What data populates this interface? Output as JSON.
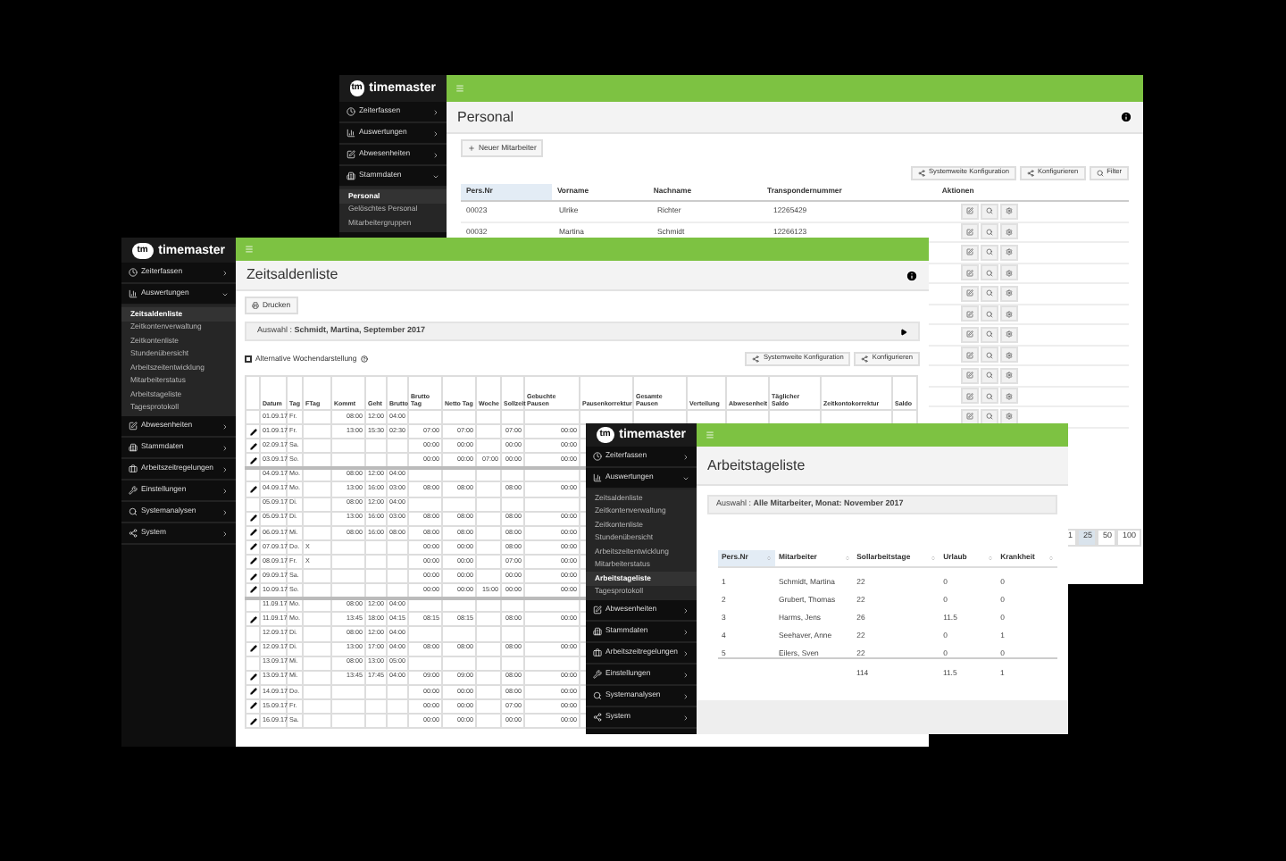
{
  "personal_window": {
    "brand": "timemaster",
    "logo_mark": "tm",
    "sidebar": [
      {
        "label": "Zeiterfassen",
        "expanded": false
      },
      {
        "label": "Auswertungen",
        "expanded": false
      },
      {
        "label": "Abwesenheiten",
        "expanded": false
      },
      {
        "label": "Stammdaten",
        "expanded": true,
        "children": [
          {
            "label": "Personal",
            "selected": true
          },
          {
            "label": "Gelöschtes Personal",
            "selected": false
          },
          {
            "label": "Mitarbeitergruppen",
            "selected": false
          }
        ]
      }
    ],
    "title": "Personal",
    "new_button": "Neuer Mitarbeiter",
    "toolbar": [
      "Systemweite Konfiguration",
      "Konfigurieren",
      "Filter"
    ],
    "columns": [
      {
        "label": "Pers.Nr",
        "sorted": true
      },
      {
        "label": "Vorname",
        "sorted": false
      },
      {
        "label": "Nachname",
        "sorted": false
      },
      {
        "label": "Transpondernummer",
        "sorted": false
      },
      {
        "label": "Aktionen",
        "sorted": false
      }
    ],
    "rows": [
      [
        "00023",
        "Ulrike",
        "Richter",
        "12265429"
      ],
      [
        "00032",
        "Martina",
        "Schmidt",
        "12266123"
      ]
    ],
    "pagination": [
      {
        "label": "1",
        "selected": false
      },
      {
        "label": "25",
        "selected": true
      },
      {
        "label": "50",
        "selected": false
      },
      {
        "label": "100",
        "selected": false
      }
    ]
  },
  "zeitsalden_window": {
    "brand": "timemaster",
    "logo_mark": "tm",
    "sidebar": [
      {
        "label": "Zeiterfassen",
        "expanded": false
      },
      {
        "label": "Auswertungen",
        "expanded": true,
        "children": [
          {
            "label": "Zeitsaldenliste",
            "selected": true
          },
          {
            "label": "Zeitkontenverwaltung",
            "selected": false
          },
          {
            "label": "Zeitkontenliste",
            "selected": false
          },
          {
            "label": "Stundenübersicht",
            "selected": false
          },
          {
            "label": "Arbeitszeitentwicklung",
            "selected": false
          },
          {
            "label": "Mitarbeiterstatus",
            "selected": false
          },
          {
            "label": "Arbeitstageliste",
            "selected": false
          },
          {
            "label": "Tagesprotokoll",
            "selected": false
          }
        ]
      },
      {
        "label": "Abwesenheiten",
        "expanded": false
      },
      {
        "label": "Stammdaten",
        "expanded": false
      },
      {
        "label": "Arbeitszeitregelungen",
        "expanded": false
      },
      {
        "label": "Einstellungen",
        "expanded": false
      },
      {
        "label": "Systemanalysen",
        "expanded": false
      },
      {
        "label": "System",
        "expanded": false
      }
    ],
    "title": "Zeitsaldenliste",
    "print_button": "Drucken",
    "selection": "Auswahl : **Schmidt, Martina, September 2017**",
    "alt_week_view": {
      "label": "Alternative Wochendarstellung",
      "checked": false
    },
    "toolbar": [
      "Systemweite Konfiguration",
      "Konfigurieren"
    ],
    "columns": [
      "Datum",
      "Tag",
      "FTag",
      "Kommt",
      "Geht",
      "Brutto",
      "Brutto Tag",
      "Netto Tag",
      "Woche",
      "Sollzeit",
      "Gebuchte Pausen",
      "Pausenkorrektur",
      "Gesamte Pausen",
      "Verteilung",
      "Abwesenheit",
      "Täglicher Saldo",
      "Zeitkontokorrektur",
      "Saldo"
    ],
    "rows": [
      {
        "edit": false,
        "week_start": false,
        "datum": "01.09.17",
        "tag": "Fr.",
        "kommt": "08:00",
        "geht": "12:00",
        "brutto": "04:00"
      },
      {
        "edit": true,
        "week_start": false,
        "datum": "01.09.17",
        "tag": "Fr.",
        "kommt": "13:00",
        "geht": "15:30",
        "brutto": "02:30",
        "brutto_tag": "07:00",
        "netto_tag": "07:00",
        "sollzeit": "07:00",
        "gebuchte_pausen": "00:00"
      },
      {
        "edit": true,
        "week_start": false,
        "datum": "02.09.17",
        "tag": "Sa.",
        "brutto_tag": "00:00",
        "netto_tag": "00:00",
        "sollzeit": "00:00",
        "gebuchte_pausen": "00:00"
      },
      {
        "edit": true,
        "week_start": false,
        "datum": "03.09.17",
        "tag": "So.",
        "brutto_tag": "00:00",
        "netto_tag": "00:00",
        "woche": "07:00",
        "sollzeit": "00:00",
        "gebuchte_pausen": "00:00"
      },
      {
        "edit": false,
        "week_start": true,
        "datum": "04.09.17",
        "tag": "Mo.",
        "kommt": "08:00",
        "geht": "12:00",
        "brutto": "04:00"
      },
      {
        "edit": true,
        "week_start": false,
        "datum": "04.09.17",
        "tag": "Mo.",
        "kommt": "13:00",
        "geht": "16:00",
        "brutto": "03:00",
        "brutto_tag": "08:00",
        "netto_tag": "08:00",
        "sollzeit": "08:00",
        "gebuchte_pausen": "00:00"
      },
      {
        "edit": false,
        "week_start": false,
        "datum": "05.09.17",
        "tag": "Di.",
        "kommt": "08:00",
        "geht": "12:00",
        "brutto": "04:00"
      },
      {
        "edit": true,
        "week_start": false,
        "datum": "05.09.17",
        "tag": "Di.",
        "kommt": "13:00",
        "geht": "16:00",
        "brutto": "03:00",
        "brutto_tag": "08:00",
        "netto_tag": "08:00",
        "sollzeit": "08:00",
        "gebuchte_pausen": "00:00"
      },
      {
        "edit": true,
        "week_start": false,
        "datum": "06.09.17",
        "tag": "Mi.",
        "kommt": "08:00",
        "geht": "16:00",
        "brutto": "08:00",
        "brutto_tag": "08:00",
        "netto_tag": "08:00",
        "sollzeit": "08:00",
        "gebuchte_pausen": "00:00"
      },
      {
        "edit": true,
        "week_start": false,
        "datum": "07.09.17",
        "tag": "Do.",
        "ftag": "X",
        "brutto_tag": "00:00",
        "netto_tag": "00:00",
        "sollzeit": "08:00",
        "gebuchte_pausen": "00:00"
      },
      {
        "edit": true,
        "week_start": false,
        "datum": "08.09.17",
        "tag": "Fr.",
        "ftag": "X",
        "brutto_tag": "00:00",
        "netto_tag": "00:00",
        "sollzeit": "07:00",
        "gebuchte_pausen": "00:00"
      },
      {
        "edit": true,
        "week_start": false,
        "datum": "09.09.17",
        "tag": "Sa.",
        "brutto_tag": "00:00",
        "netto_tag": "00:00",
        "sollzeit": "00:00",
        "gebuchte_pausen": "00:00"
      },
      {
        "edit": true,
        "week_start": false,
        "datum": "10.09.17",
        "tag": "So.",
        "brutto_tag": "00:00",
        "netto_tag": "00:00",
        "woche": "15:00",
        "sollzeit": "00:00",
        "gebuchte_pausen": "00:00"
      },
      {
        "edit": false,
        "week_start": true,
        "datum": "11.09.17",
        "tag": "Mo.",
        "kommt": "08:00",
        "geht": "12:00",
        "brutto": "04:00"
      },
      {
        "edit": true,
        "week_start": false,
        "datum": "11.09.17",
        "tag": "Mo.",
        "kommt": "13:45",
        "geht": "18:00",
        "brutto": "04:15",
        "brutto_tag": "08:15",
        "netto_tag": "08:15",
        "sollzeit": "08:00",
        "gebuchte_pausen": "00:00"
      },
      {
        "edit": false,
        "week_start": false,
        "datum": "12.09.17",
        "tag": "Di.",
        "kommt": "08:00",
        "geht": "12:00",
        "brutto": "04:00"
      },
      {
        "edit": true,
        "week_start": false,
        "datum": "12.09.17",
        "tag": "Di.",
        "kommt": "13:00",
        "geht": "17:00",
        "brutto": "04:00",
        "brutto_tag": "08:00",
        "netto_tag": "08:00",
        "sollzeit": "08:00",
        "gebuchte_pausen": "00:00"
      },
      {
        "edit": false,
        "week_start": false,
        "datum": "13.09.17",
        "tag": "Mi.",
        "kommt": "08:00",
        "geht": "13:00",
        "brutto": "05:00"
      },
      {
        "edit": true,
        "week_start": false,
        "datum": "13.09.17",
        "tag": "Mi.",
        "kommt": "13:45",
        "geht": "17:45",
        "brutto": "04:00",
        "brutto_tag": "09:00",
        "netto_tag": "09:00",
        "sollzeit": "08:00",
        "gebuchte_pausen": "00:00"
      },
      {
        "edit": true,
        "week_start": false,
        "datum": "14.09.17",
        "tag": "Do.",
        "brutto_tag": "00:00",
        "netto_tag": "00:00",
        "sollzeit": "08:00",
        "gebuchte_pausen": "00:00"
      },
      {
        "edit": true,
        "week_start": false,
        "datum": "15.09.17",
        "tag": "Fr.",
        "brutto_tag": "00:00",
        "netto_tag": "00:00",
        "sollzeit": "07:00",
        "gebuchte_pausen": "00:00"
      },
      {
        "edit": true,
        "week_start": false,
        "datum": "16.09.17",
        "tag": "Sa.",
        "brutto_tag": "00:00",
        "netto_tag": "00:00",
        "sollzeit": "00:00",
        "gebuchte_pausen": "00:00"
      }
    ]
  },
  "arbeitstage_window": {
    "brand": "timemaster",
    "logo_mark": "tm",
    "sidebar": [
      {
        "label": "Zeiterfassen",
        "expanded": false
      },
      {
        "label": "Auswertungen",
        "expanded": true,
        "children": [
          {
            "label": "Zeitsaldenliste",
            "selected": false
          },
          {
            "label": "Zeitkontenverwaltung",
            "selected": false
          },
          {
            "label": "Zeitkontenliste",
            "selected": false
          },
          {
            "label": "Stundenübersicht",
            "selected": false
          },
          {
            "label": "Arbeitszeitentwicklung",
            "selected": false
          },
          {
            "label": "Mitarbeiterstatus",
            "selected": false
          },
          {
            "label": "Arbeitstageliste",
            "selected": true
          },
          {
            "label": "Tagesprotokoll",
            "selected": false
          }
        ]
      },
      {
        "label": "Abwesenheiten",
        "expanded": false
      },
      {
        "label": "Stammdaten",
        "expanded": false
      },
      {
        "label": "Arbeitszeitregelungen",
        "expanded": false
      },
      {
        "label": "Einstellungen",
        "expanded": false
      },
      {
        "label": "Systemanalysen",
        "expanded": false
      },
      {
        "label": "System",
        "expanded": false
      }
    ],
    "title": "Arbeitstageliste",
    "selection": "Auswahl : **Alle Mitarbeiter, Monat: November 2017**",
    "columns": [
      {
        "label": "Pers.Nr",
        "sorted": true
      },
      {
        "label": "Mitarbeiter",
        "sorted": false
      },
      {
        "label": "Sollarbeitstage",
        "sorted": false
      },
      {
        "label": "Urlaub",
        "sorted": false
      },
      {
        "label": "Krankheit",
        "sorted": false
      }
    ],
    "rows": [
      [
        "1",
        "Schmidt, Martina",
        "22",
        "0",
        "0"
      ],
      [
        "2",
        "Grubert, Thomas",
        "22",
        "0",
        "0"
      ],
      [
        "3",
        "Harms, Jens",
        "26",
        "11.5",
        "0"
      ],
      [
        "4",
        "Seehaver, Anne",
        "22",
        "0",
        "1"
      ],
      [
        "5",
        "Eilers, Sven",
        "22",
        "0",
        "0"
      ]
    ],
    "totals": [
      "114",
      "11.5",
      "1"
    ]
  }
}
